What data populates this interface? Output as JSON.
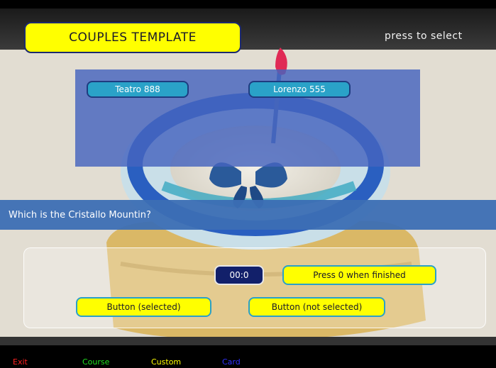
{
  "header": {
    "title": "COUPLES TEMPLATE",
    "hint": "press to select"
  },
  "answers": [
    {
      "label": "Teatro 888"
    },
    {
      "label": "Lorenzo 555"
    }
  ],
  "question": "Which is the Cristallo Mountin?",
  "controls": {
    "timer": "00:0",
    "finish_label": "Press 0 when finished",
    "selected_label": "Button (selected)",
    "not_selected_label": "Button (not selected)"
  },
  "footer": {
    "exit": "Exit",
    "course": "Course",
    "custom": "Custom",
    "card": "Card"
  },
  "colors": {
    "title_bg": "#ffff00",
    "answer_bg": "#2aa2c8",
    "panel_bg": "#4664be",
    "question_bg": "#3c6eb4",
    "timer_bg": "#12206a",
    "exit": "#ff2020",
    "course": "#20e020",
    "custom": "#ffff00",
    "card": "#3030ff"
  }
}
